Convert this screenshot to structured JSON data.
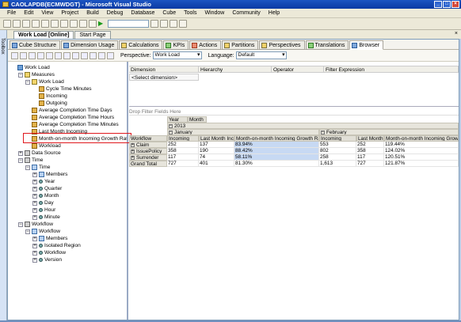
{
  "window": {
    "title": "CAOLAPDB(ECMWDGT) - Microsoft Visual Studio",
    "controls": [
      "_",
      "□",
      "×"
    ]
  },
  "menu": [
    "File",
    "Edit",
    "View",
    "Project",
    "Build",
    "Debug",
    "Database",
    "Cube",
    "Tools",
    "Window",
    "Community",
    "Help"
  ],
  "toolbox_label": "Toolbox",
  "doc_tabs": [
    {
      "label": "Work Load [Online]",
      "active": true
    },
    {
      "label": "Start Page",
      "active": false
    }
  ],
  "designer_tabs": [
    {
      "label": "Cube Structure",
      "icon": "cube-structure-icon",
      "active": false
    },
    {
      "label": "Dimension Usage",
      "icon": "dimension-usage-icon",
      "active": false
    },
    {
      "label": "Calculations",
      "icon": "calculations-icon",
      "active": false
    },
    {
      "label": "KPIs",
      "icon": "kpi-icon",
      "active": false
    },
    {
      "label": "Actions",
      "icon": "actions-icon",
      "active": false
    },
    {
      "label": "Partitions",
      "icon": "partitions-icon",
      "active": false
    },
    {
      "label": "Perspectives",
      "icon": "perspectives-icon",
      "active": false
    },
    {
      "label": "Translations",
      "icon": "translations-icon",
      "active": false
    },
    {
      "label": "Browser",
      "icon": "browser-icon",
      "active": true
    }
  ],
  "browser_toolbar": {
    "perspective_label": "Perspective:",
    "perspective_value": "Work Load",
    "language_label": "Language:",
    "language_value": "Default"
  },
  "tree": [
    {
      "label": "Work Load",
      "level": 0,
      "icon": "cube",
      "expander": ""
    },
    {
      "label": "Measures",
      "level": 1,
      "icon": "folder",
      "expander": "-"
    },
    {
      "label": "Work Load",
      "level": 2,
      "icon": "folder",
      "expander": "-"
    },
    {
      "label": "Cycle Time Minutes",
      "level": 3,
      "icon": "measure",
      "expander": ""
    },
    {
      "label": "Incoming",
      "level": 3,
      "icon": "measure",
      "expander": ""
    },
    {
      "label": "Outgoing",
      "level": 3,
      "icon": "measure",
      "expander": ""
    },
    {
      "label": "Average Completion Time Days",
      "level": 2,
      "icon": "measure",
      "expander": ""
    },
    {
      "label": "Average Completion Time Hours",
      "level": 2,
      "icon": "measure",
      "expander": ""
    },
    {
      "label": "Average Completion Time Minutes",
      "level": 2,
      "icon": "measure",
      "expander": ""
    },
    {
      "label": "Last Month Incoming",
      "level": 2,
      "icon": "measure",
      "expander": ""
    },
    {
      "label": "Month-on-month Incoming Growth Rate",
      "level": 2,
      "icon": "measure",
      "expander": ""
    },
    {
      "label": "Workload",
      "level": 2,
      "icon": "measure",
      "expander": ""
    },
    {
      "label": "Data Source",
      "level": 1,
      "icon": "dim",
      "expander": "+"
    },
    {
      "label": "Time",
      "level": 1,
      "icon": "dim",
      "expander": "-"
    },
    {
      "label": "Time",
      "level": 2,
      "icon": "hier",
      "expander": "-"
    },
    {
      "label": "Members",
      "level": 3,
      "icon": "hier",
      "expander": "+"
    },
    {
      "label": "Year",
      "level": 3,
      "icon": "attr",
      "expander": "+"
    },
    {
      "label": "Quarter",
      "level": 3,
      "icon": "attr",
      "expander": "+"
    },
    {
      "label": "Month",
      "level": 3,
      "icon": "attr",
      "expander": "+"
    },
    {
      "label": "Day",
      "level": 3,
      "icon": "attr",
      "expander": "+"
    },
    {
      "label": "Hour",
      "level": 3,
      "icon": "attr",
      "expander": "+"
    },
    {
      "label": "Minute",
      "level": 3,
      "icon": "attr",
      "expander": "+"
    },
    {
      "label": "Workflow",
      "level": 1,
      "icon": "dim",
      "expander": "-"
    },
    {
      "label": "Workflow",
      "level": 2,
      "icon": "hier",
      "expander": "-"
    },
    {
      "label": "Members",
      "level": 3,
      "icon": "hier",
      "expander": "+"
    },
    {
      "label": "Isolated Region",
      "level": 3,
      "icon": "attr",
      "expander": "+"
    },
    {
      "label": "Workflow",
      "level": 3,
      "icon": "attr",
      "expander": "+"
    },
    {
      "label": "Version",
      "level": 3,
      "icon": "attr",
      "expander": "+"
    }
  ],
  "filter_grid": {
    "columns": [
      "Dimension",
      "Hierarchy",
      "Operator",
      "Filter Expression"
    ],
    "placeholder": "<Select dimension>"
  },
  "pivot": {
    "drop_hint": "Drop Filter Fields Here",
    "col_fields": [
      "Year",
      "Month"
    ],
    "year": "2013",
    "months": [
      "January",
      "February"
    ],
    "row_field": "Workflow",
    "measure_headers": [
      "Incoming",
      "Last Month Incoming",
      "Month-on-month Incoming Growth Rate",
      "Incoming",
      "Last Month Incoming",
      "Month-on-month Incoming Growth Rate"
    ],
    "rows": [
      {
        "label": "Claim",
        "values": [
          "252",
          "137",
          "83.94%",
          "553",
          "252",
          "119.44%"
        ]
      },
      {
        "label": "IssuePolicy",
        "values": [
          "358",
          "190",
          "88.42%",
          "802",
          "358",
          "124.02%"
        ]
      },
      {
        "label": "Surrender",
        "values": [
          "117",
          "74",
          "58.11%",
          "258",
          "117",
          "120.51%"
        ]
      },
      {
        "label": "Grand Total",
        "values": [
          "727",
          "401",
          "81.30%",
          "1,613",
          "727",
          "121.87%"
        ]
      }
    ]
  }
}
